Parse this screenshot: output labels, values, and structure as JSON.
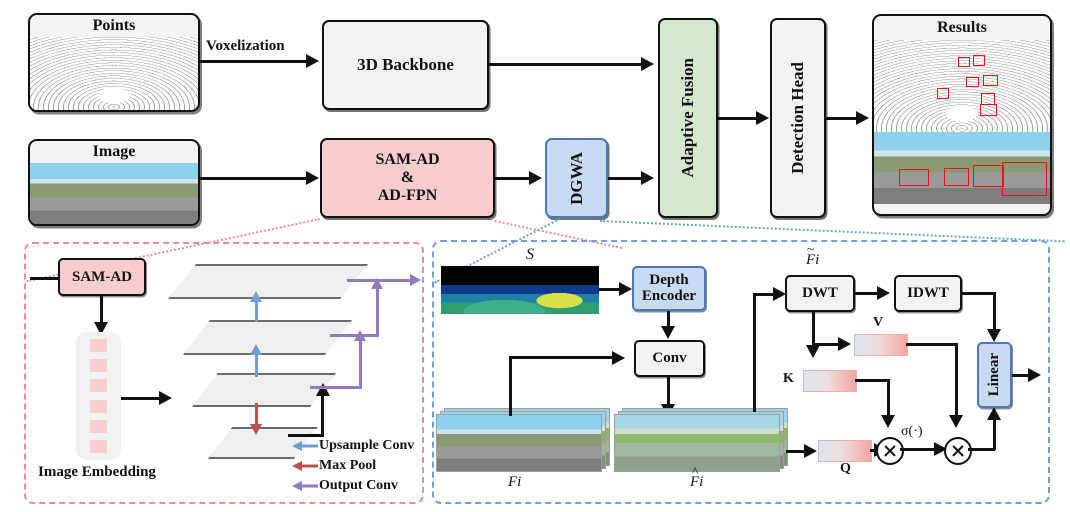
{
  "pipeline": {
    "points_box": {
      "caption": "Points"
    },
    "image_box": {
      "caption": "Image"
    },
    "voxelization_label": "Voxelization",
    "backbone_box": {
      "label": "3D Backbone"
    },
    "samad_box": {
      "line1": "SAM-AD",
      "line2": "&",
      "line3": "AD-FPN"
    },
    "dgwa_box": {
      "label": "DGWA"
    },
    "fusion_box": {
      "label": "Adaptive Fusion"
    },
    "head_box": {
      "label": "Detection Head"
    },
    "results_box": {
      "caption": "Results"
    }
  },
  "samad_panel": {
    "samad_box_label": "SAM-AD",
    "embedding_label": "Image Embedding",
    "legend": [
      {
        "label": "Upsample Conv",
        "color": "#6e9ed2"
      },
      {
        "label": "Max Pool",
        "color": "#c0504d"
      },
      {
        "label": "Output Conv",
        "color": "#8f7bbd"
      }
    ]
  },
  "dgwa_panel": {
    "depth_input_label": "S",
    "depth_encoder_box": {
      "line1": "Depth",
      "line2": "Encoder"
    },
    "conv_box": {
      "label": "Conv"
    },
    "feature_label": "Fi",
    "fused_feature_label": "Fi",
    "wavelet_feature_label": "Fi",
    "dwt_box": {
      "label": "DWT"
    },
    "idwt_box": {
      "label": "IDWT"
    },
    "linear_box": {
      "label": "Linear"
    },
    "q_label": "Q",
    "k_label": "K",
    "v_label": "V",
    "sigma_label": "σ(·)"
  },
  "colors": {
    "pink_fill": "#f9ccce",
    "blue_fill": "#c7dcf2",
    "green_fill": "#d5e7cf",
    "gray_fill": "#f3f3f3",
    "pink_dash": "#f08c90",
    "blue_dash": "#6f9ed8",
    "stroke": "#111111"
  }
}
